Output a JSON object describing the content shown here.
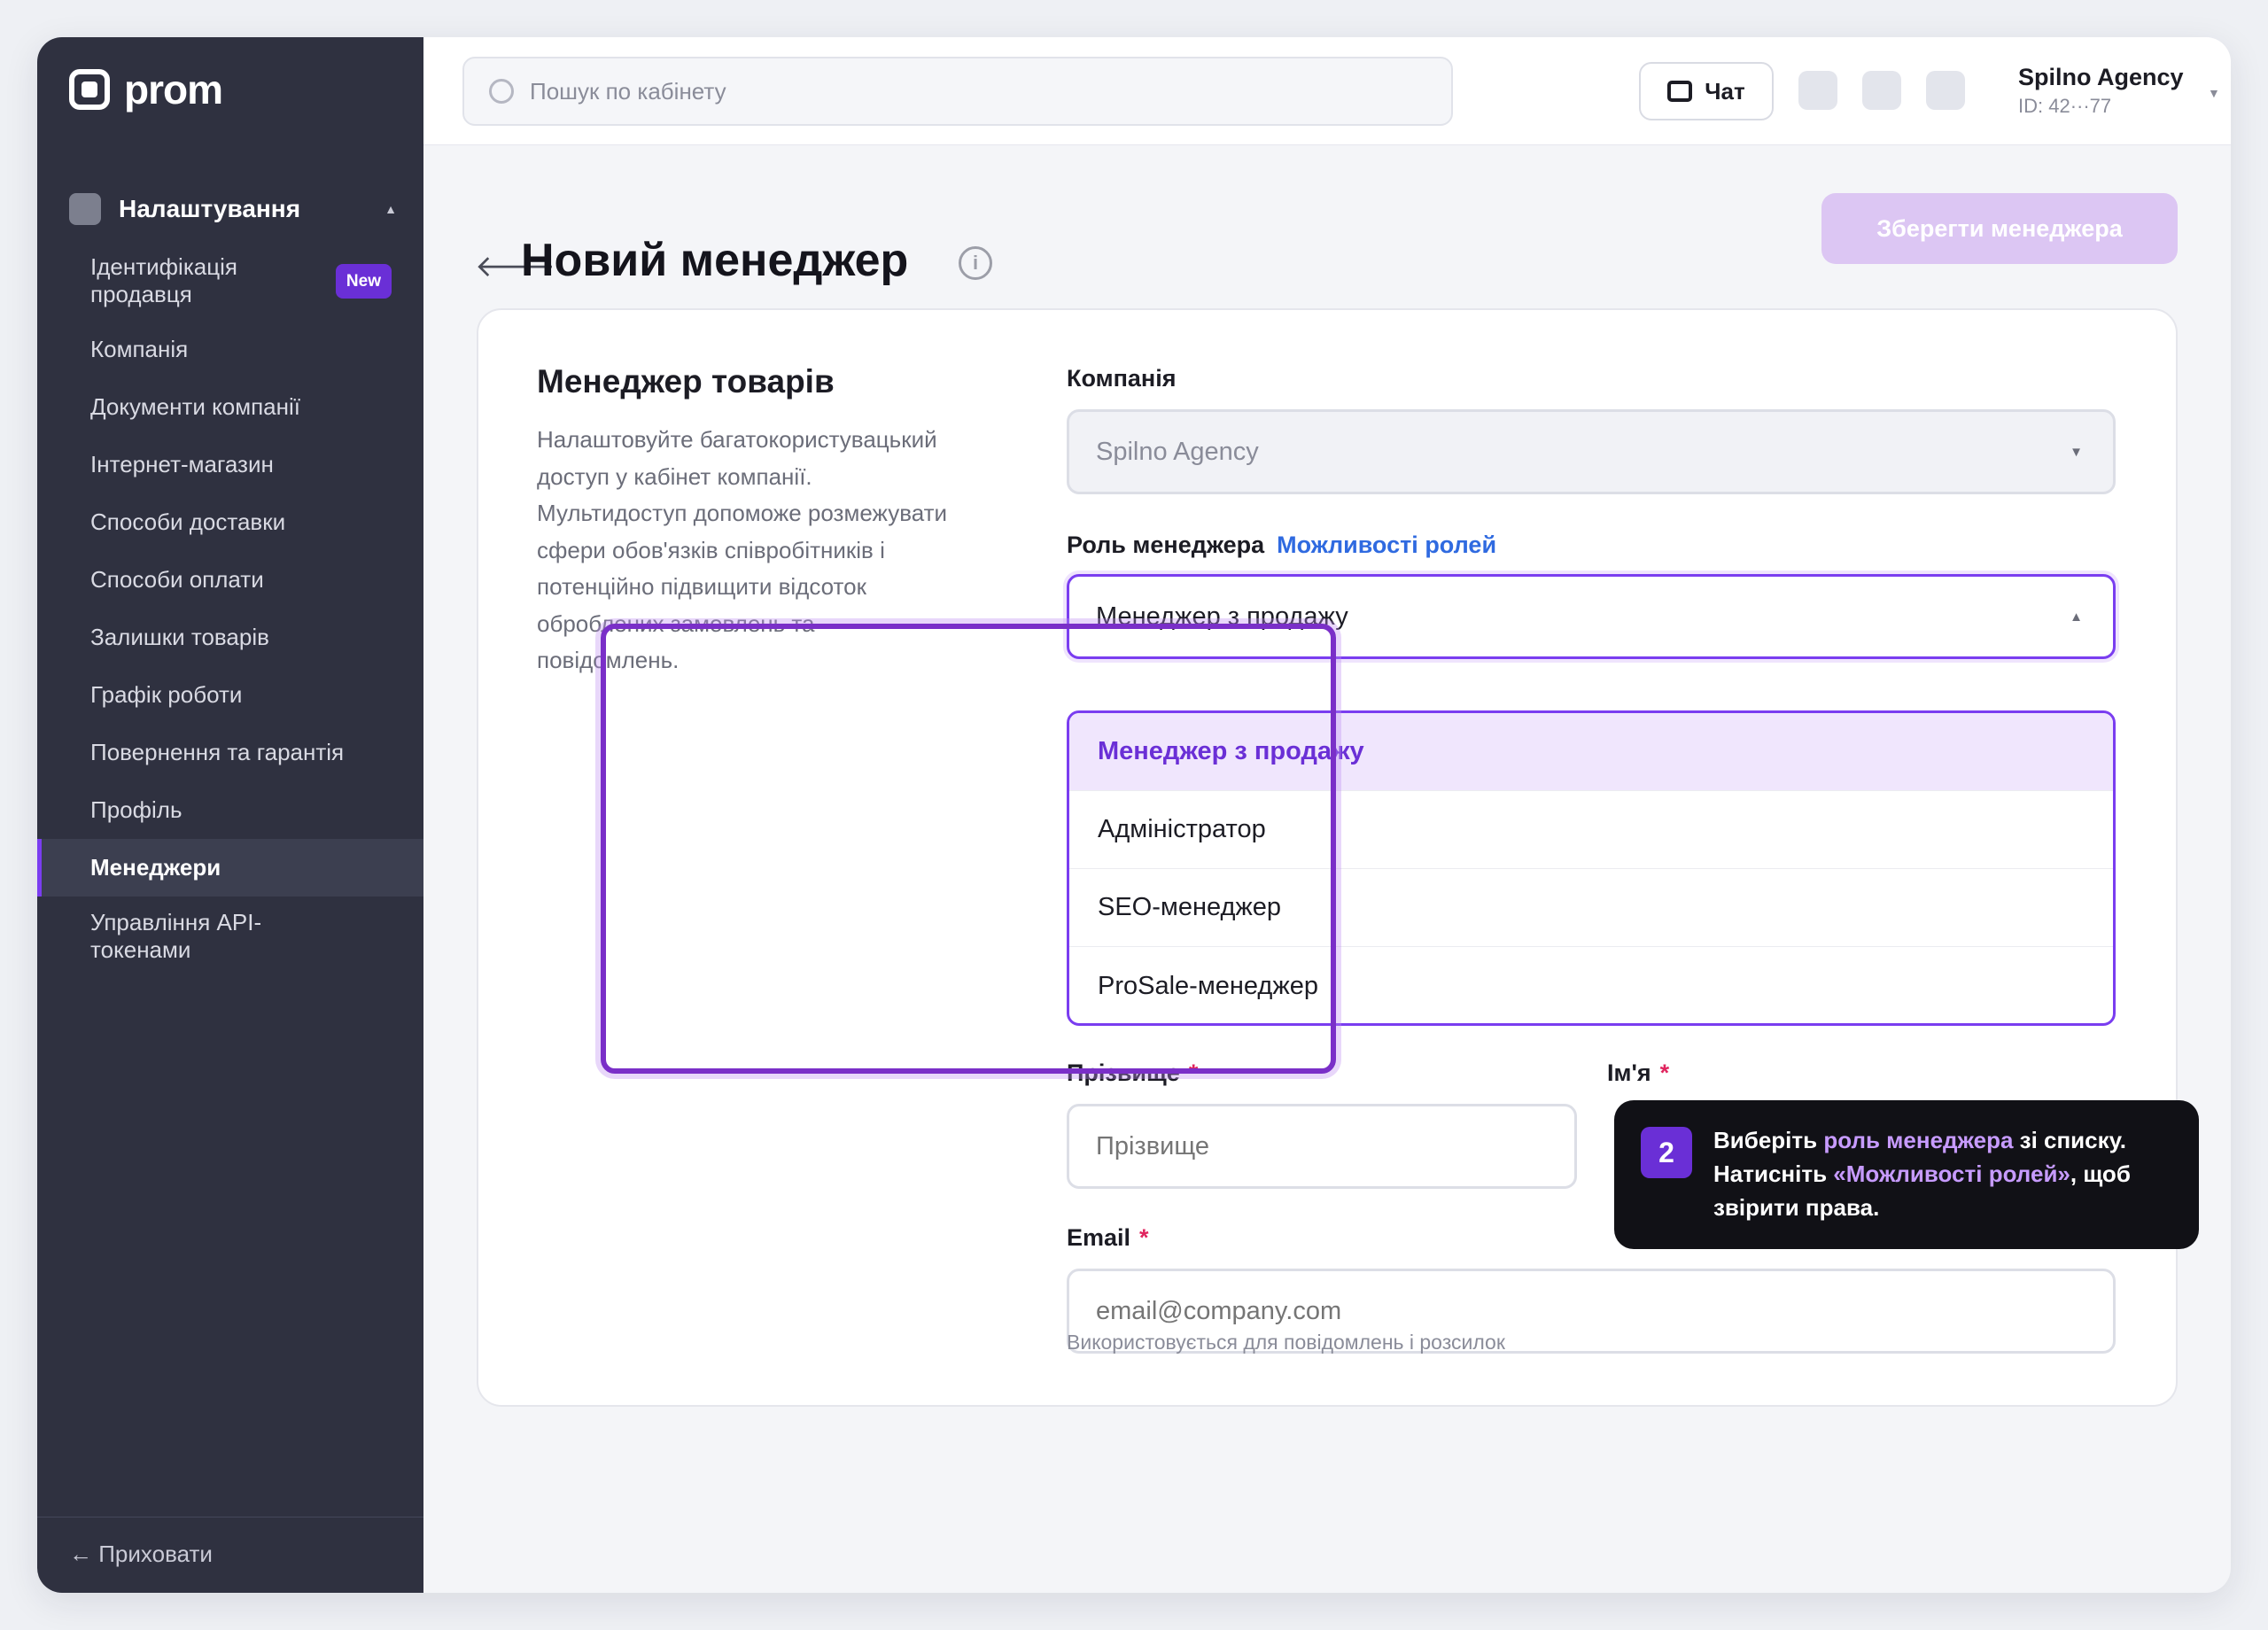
{
  "brand": {
    "logo_text": "prom"
  },
  "sidebar": {
    "section_title": "Налаштування",
    "items": [
      {
        "label": "Ідентифікація продавця",
        "badge": "New"
      },
      {
        "label": "Компанія"
      },
      {
        "label": "Документи компанії"
      },
      {
        "label": "Інтернет-магазин"
      },
      {
        "label": "Способи доставки"
      },
      {
        "label": "Способи оплати"
      },
      {
        "label": "Залишки товарів"
      },
      {
        "label": "Графік роботи"
      },
      {
        "label": "Повернення та гарантія"
      },
      {
        "label": "Профіль"
      },
      {
        "label": "Менеджери",
        "active": true
      },
      {
        "label": "Управління API-токенами"
      }
    ],
    "hide_label": "← Приховати"
  },
  "topbar": {
    "search_placeholder": "Пошук по кабінету",
    "chat_label": "Чат",
    "account_name": "Spilno Agency",
    "account_id": "ID: 42···77"
  },
  "page": {
    "back_icon": "back-arrow-icon",
    "title": "Новий менеджер",
    "info_icon": "i",
    "save_label": "Зберегти менеджера"
  },
  "card": {
    "title": "Менеджер товарів",
    "description": "Налаштовуйте багатокористувацький доступ у кабінет компанії. Мультидоступ допоможе розмежувати сфери обов'язків співробітників і потенційно підвищити відсоток оброблених замовлень та повідомлень.",
    "company_label": "Компанія",
    "company_value": "Spilno Agency",
    "role_label": "Роль менеджера",
    "role_link": "Можливості ролей",
    "role_value": "Менеджер з продажу",
    "role_options": [
      "Менеджер з продажу",
      "Адміністратор",
      "SEO-менеджер",
      "ProSale-менеджер"
    ],
    "surname_label": "Прізвище",
    "surname_placeholder": "Прізвище",
    "name_label": "Ім'я",
    "email_label": "Email",
    "email_placeholder": "email@company.com",
    "email_hint": "Використовується для повідомлень і розсилок",
    "required_mark": "*"
  },
  "tooltip": {
    "step": "2",
    "line1_a": "Виберіть ",
    "line1_hl": "роль менеджера",
    "line1_b": " зі списку.",
    "line2_a": "Натисніть ",
    "line2_hl": "«Можливості ролей»",
    "line2_b": ", щоб",
    "line3": "звірити права."
  },
  "colors": {
    "accent": "#7a3df0",
    "sidebar_bg": "#2f3140",
    "link": "#2f6ae0",
    "required": "#e0245e"
  }
}
